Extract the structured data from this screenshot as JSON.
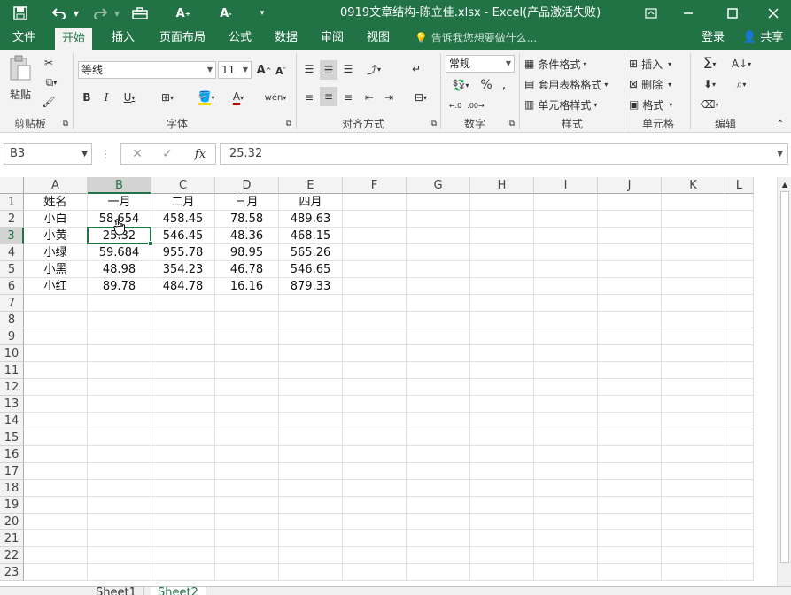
{
  "titlebar": {
    "title": "0919文章结构-陈立佳.xlsx - Excel(产品激活失败)",
    "save_icon": "save-icon",
    "undo_icon": "undo-icon",
    "redo_icon": "redo-icon",
    "minimize": "minimize-icon",
    "maximize": "maximize-icon",
    "close": "close-icon"
  },
  "tabs": [
    "文件",
    "开始",
    "插入",
    "页面布局",
    "公式",
    "数据",
    "审阅",
    "视图"
  ],
  "active_tab": "开始",
  "tellme": "告诉我您想要做什么...",
  "login": "登录",
  "share": "共享",
  "ribbon": {
    "clipboard": {
      "paste": "粘贴",
      "label": "剪贴板"
    },
    "font": {
      "name": "等线",
      "size": "11",
      "label": "字体",
      "wen": "wén"
    },
    "alignment": {
      "label": "对齐方式"
    },
    "number": {
      "format": "常规",
      "label": "数字",
      "percent": "%"
    },
    "styles": {
      "cond": "条件格式",
      "table": "套用表格格式",
      "cell": "单元格样式",
      "label": "样式"
    },
    "cells": {
      "insert": "插入",
      "delete": "删除",
      "format": "格式",
      "label": "单元格"
    },
    "editing": {
      "label": "编辑"
    }
  },
  "formula_bar": {
    "name_box": "B3",
    "value": "25.32",
    "fx": "fx"
  },
  "columns": [
    "A",
    "B",
    "C",
    "D",
    "E",
    "F",
    "G",
    "H",
    "I",
    "J",
    "K",
    "L"
  ],
  "rows": [
    "1",
    "2",
    "3",
    "4",
    "5",
    "6",
    "7",
    "8",
    "9",
    "10",
    "11",
    "12",
    "13",
    "14",
    "15",
    "16",
    "17",
    "18",
    "19",
    "20",
    "21",
    "22",
    "23"
  ],
  "sheet": [
    [
      "姓名",
      "一月",
      "二月",
      "三月",
      "四月"
    ],
    [
      "小白",
      "58.654",
      "458.45",
      "78.58",
      "489.63"
    ],
    [
      "小黄",
      "25.32",
      "546.45",
      "48.36",
      "468.15"
    ],
    [
      "小绿",
      "59.684",
      "955.78",
      "98.95",
      "565.26"
    ],
    [
      "小黑",
      "48.98",
      "354.23",
      "46.78",
      "546.65"
    ],
    [
      "小红",
      "89.78",
      "484.78",
      "16.16",
      "879.33"
    ]
  ],
  "selected_cell": "B3",
  "sheet_tabs": [
    "Sheet1",
    "Sheet2"
  ],
  "active_sheet": "Sheet2",
  "colors": {
    "accent": "#217346",
    "ribbon_bg": "#f3f3f3"
  }
}
